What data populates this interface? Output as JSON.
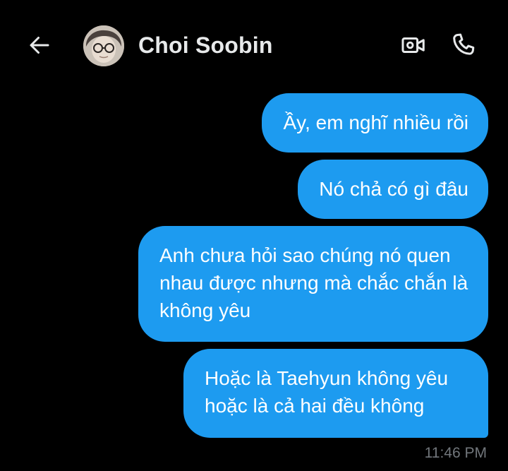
{
  "header": {
    "contact_name": "Choi Soobin",
    "back_icon": "arrow-left-icon",
    "video_icon": "video-camera-icon",
    "call_icon": "phone-icon"
  },
  "messages": [
    {
      "text": "Ầy, em nghĩ nhiều rồi",
      "sender": "me"
    },
    {
      "text": "Nó chả có gì đâu",
      "sender": "me"
    },
    {
      "text": "Anh chưa hỏi sao chúng nó quen nhau được nhưng mà chắc chắn là không yêu",
      "sender": "me"
    },
    {
      "text": "Hoặc là Taehyun không yêu hoặc là cả hai đều không",
      "sender": "me"
    }
  ],
  "timestamp": "11:46 PM",
  "colors": {
    "background": "#000000",
    "bubble": "#1d9bf0",
    "text": "#e7e9ea",
    "muted": "#71767b"
  }
}
